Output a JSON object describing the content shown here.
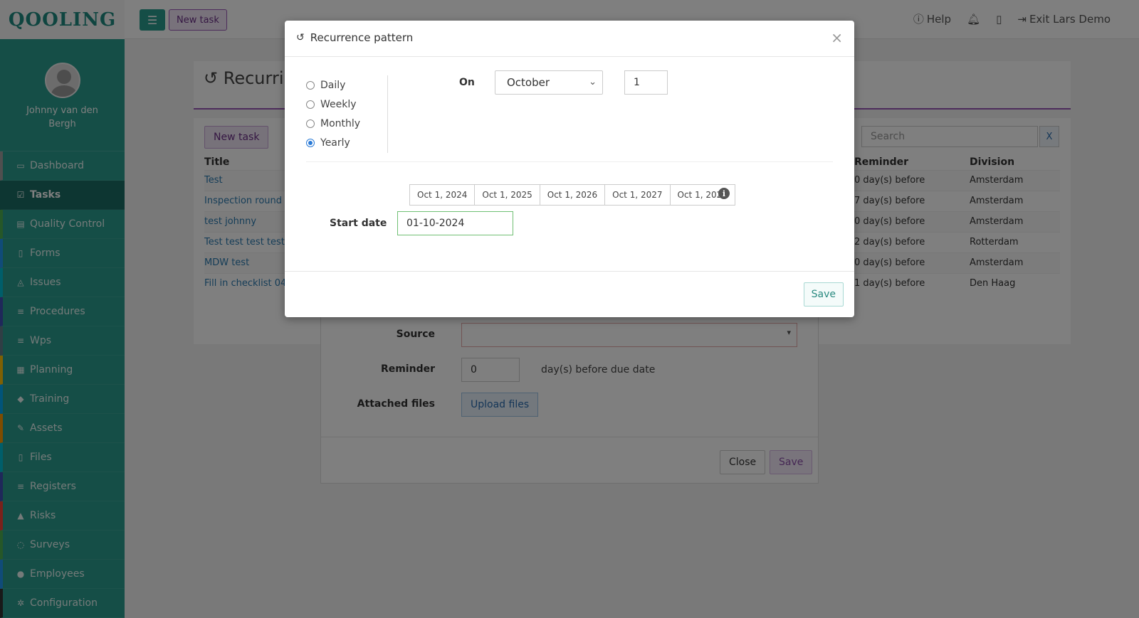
{
  "topbar": {
    "logo": "QOOLING",
    "new_task_label": "New task",
    "help_label": "Help",
    "exit_label": "Exit Lars Demo"
  },
  "sidebar": {
    "username": "Johnny van den Bergh",
    "items": [
      {
        "label": "Dashboard",
        "icon": "monitor-icon",
        "color": "#9e9e9e"
      },
      {
        "label": "Tasks",
        "icon": "check-square-icon",
        "color": "#1b6d64"
      },
      {
        "label": "Quality Control",
        "icon": "clipboard-icon",
        "color": "#4caf50"
      },
      {
        "label": "Forms",
        "icon": "file-icon",
        "color": "#2196f3"
      },
      {
        "label": "Issues",
        "icon": "bell-icon",
        "color": "#00bcd4"
      },
      {
        "label": "Procedures",
        "icon": "list-icon",
        "color": "#3f51b5"
      },
      {
        "label": "Wps",
        "icon": "list-icon",
        "color": "#607d8b"
      },
      {
        "label": "Planning",
        "icon": "calendar-icon",
        "color": "#ffc107"
      },
      {
        "label": "Training",
        "icon": "graduation-cap-icon",
        "color": "#03a9f4"
      },
      {
        "label": "Assets",
        "icon": "wrench-icon",
        "color": "#ff9800"
      },
      {
        "label": "Files",
        "icon": "file-icon",
        "color": "#00bcd4"
      },
      {
        "label": "Registers",
        "icon": "list-icon",
        "color": "#3f51b5"
      },
      {
        "label": "Risks",
        "icon": "warning-icon",
        "color": "#f44336"
      },
      {
        "label": "Surveys",
        "icon": "comment-icon",
        "color": "#4caf50"
      },
      {
        "label": "Employees",
        "icon": "users-icon",
        "color": "#2196f3"
      },
      {
        "label": "Configuration",
        "icon": "gear-icon",
        "color": "#333333"
      }
    ]
  },
  "page": {
    "title": "Recurri",
    "new_task_label": "New task",
    "search_placeholder": "Search",
    "search_clear": "X",
    "columns": {
      "title": "Title",
      "reminder": "Reminder",
      "division": "Division"
    },
    "rows": [
      {
        "title": "Test",
        "reminder": "0 day(s) before",
        "division": "Amsterdam"
      },
      {
        "title": "Inspection round",
        "reminder": "7 day(s) before",
        "division": "Amsterdam"
      },
      {
        "title": "test johnny",
        "reminder": "0 day(s) before",
        "division": "Amsterdam"
      },
      {
        "title": "Test test test test",
        "reminder": "2 day(s) before",
        "division": "Rotterdam"
      },
      {
        "title": "MDW test",
        "reminder": "0 day(s) before",
        "division": "Amsterdam"
      },
      {
        "title": "Fill in checklist 04",
        "reminder": "1 day(s) before",
        "division": "Den Haag"
      }
    ]
  },
  "task_form": {
    "source_label": "Source",
    "reminder_label": "Reminder",
    "reminder_value": "0",
    "reminder_suffix": "day(s) before due date",
    "attached_label": "Attached files",
    "upload_label": "Upload files",
    "close_label": "Close",
    "save_label": "Save"
  },
  "modal": {
    "title": "Recurrence pattern",
    "close_symbol": "×",
    "frequencies": [
      {
        "label": "Daily",
        "checked": false
      },
      {
        "label": "Weekly",
        "checked": false
      },
      {
        "label": "Monthly",
        "checked": false
      },
      {
        "label": "Yearly",
        "checked": true
      }
    ],
    "on_label": "On",
    "month_value": "October",
    "day_value": "1",
    "preview_dates": [
      "Oct 1, 2024",
      "Oct 1, 2025",
      "Oct 1, 2026",
      "Oct 1, 2027",
      "Oct 1, 2028"
    ],
    "start_date_label": "Start date",
    "start_date_value": "01-10-2024",
    "save_label": "Save"
  }
}
